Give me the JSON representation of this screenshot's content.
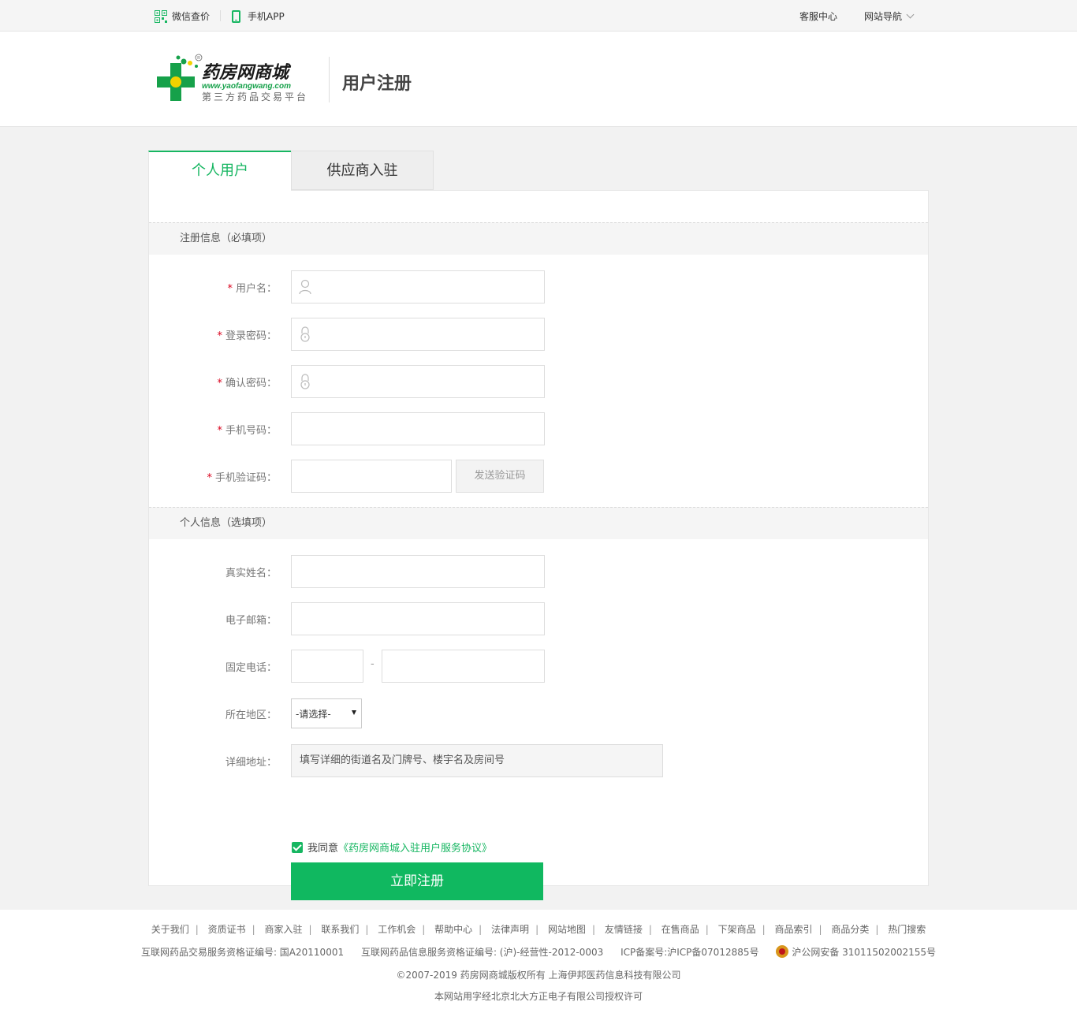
{
  "topbar": {
    "wechat_price": "微信查价",
    "mobile_app": "手机APP",
    "service_center": "客服中心",
    "site_nav": "网站导航"
  },
  "header": {
    "logo_brand": "药房网商城",
    "logo_url": "www.yaofangwang.com",
    "logo_slogan": "第三方药品交易平台",
    "page_title": "用户注册"
  },
  "tabs": [
    {
      "label": "个人用户",
      "active": true
    },
    {
      "label": "供应商入驻",
      "active": false
    }
  ],
  "sections": {
    "required": "注册信息（必填项）",
    "optional": "个人信息（选填项）"
  },
  "required_fields": {
    "username": "用户名：",
    "password": "登录密码：",
    "confirm_password": "确认密码：",
    "phone": "手机号码：",
    "sms_code": "手机验证码：",
    "send_code_button": "发送验证码",
    "required_mark": "*"
  },
  "optional_fields": {
    "real_name": "真实姓名：",
    "email": "电子邮箱：",
    "landline": "固定电话：",
    "landline_dash": "-",
    "region": "所在地区：",
    "region_selected": "-请选择-",
    "address": "详细地址：",
    "address_placeholder": "填写详细的街道名及门牌号、楼宇名及房间号"
  },
  "agreement": {
    "checked": true,
    "prefix": "我同意",
    "link": "《药房网商城入驻用户服务协议》"
  },
  "submit_label": "立即注册",
  "footer": {
    "links": [
      "关于我们",
      "资质证书",
      "商家入驻",
      "联系我们",
      "工作机会",
      "帮助中心",
      "法律声明",
      "网站地图",
      "友情链接",
      "在售商品",
      "下架商品",
      "商品索引",
      "商品分类",
      "热门搜索"
    ],
    "license1": "互联网药品交易服务资格证编号: 国A20110001",
    "license2": "互联网药品信息服务资格证编号: (沪)-经营性-2012-0003",
    "icp": "ICP备案号:沪ICP备07012885号",
    "police": "沪公网安备 31011502002155号",
    "copyright": "©2007-2019  药房网商城版权所有  上海伊邦医药信息科技有限公司",
    "font_license": "本网站用字经北京北大方正电子有限公司授权许可"
  },
  "colors": {
    "brand_green": "#16b661",
    "submit_green": "#10b860",
    "required_red": "#d9001b"
  }
}
